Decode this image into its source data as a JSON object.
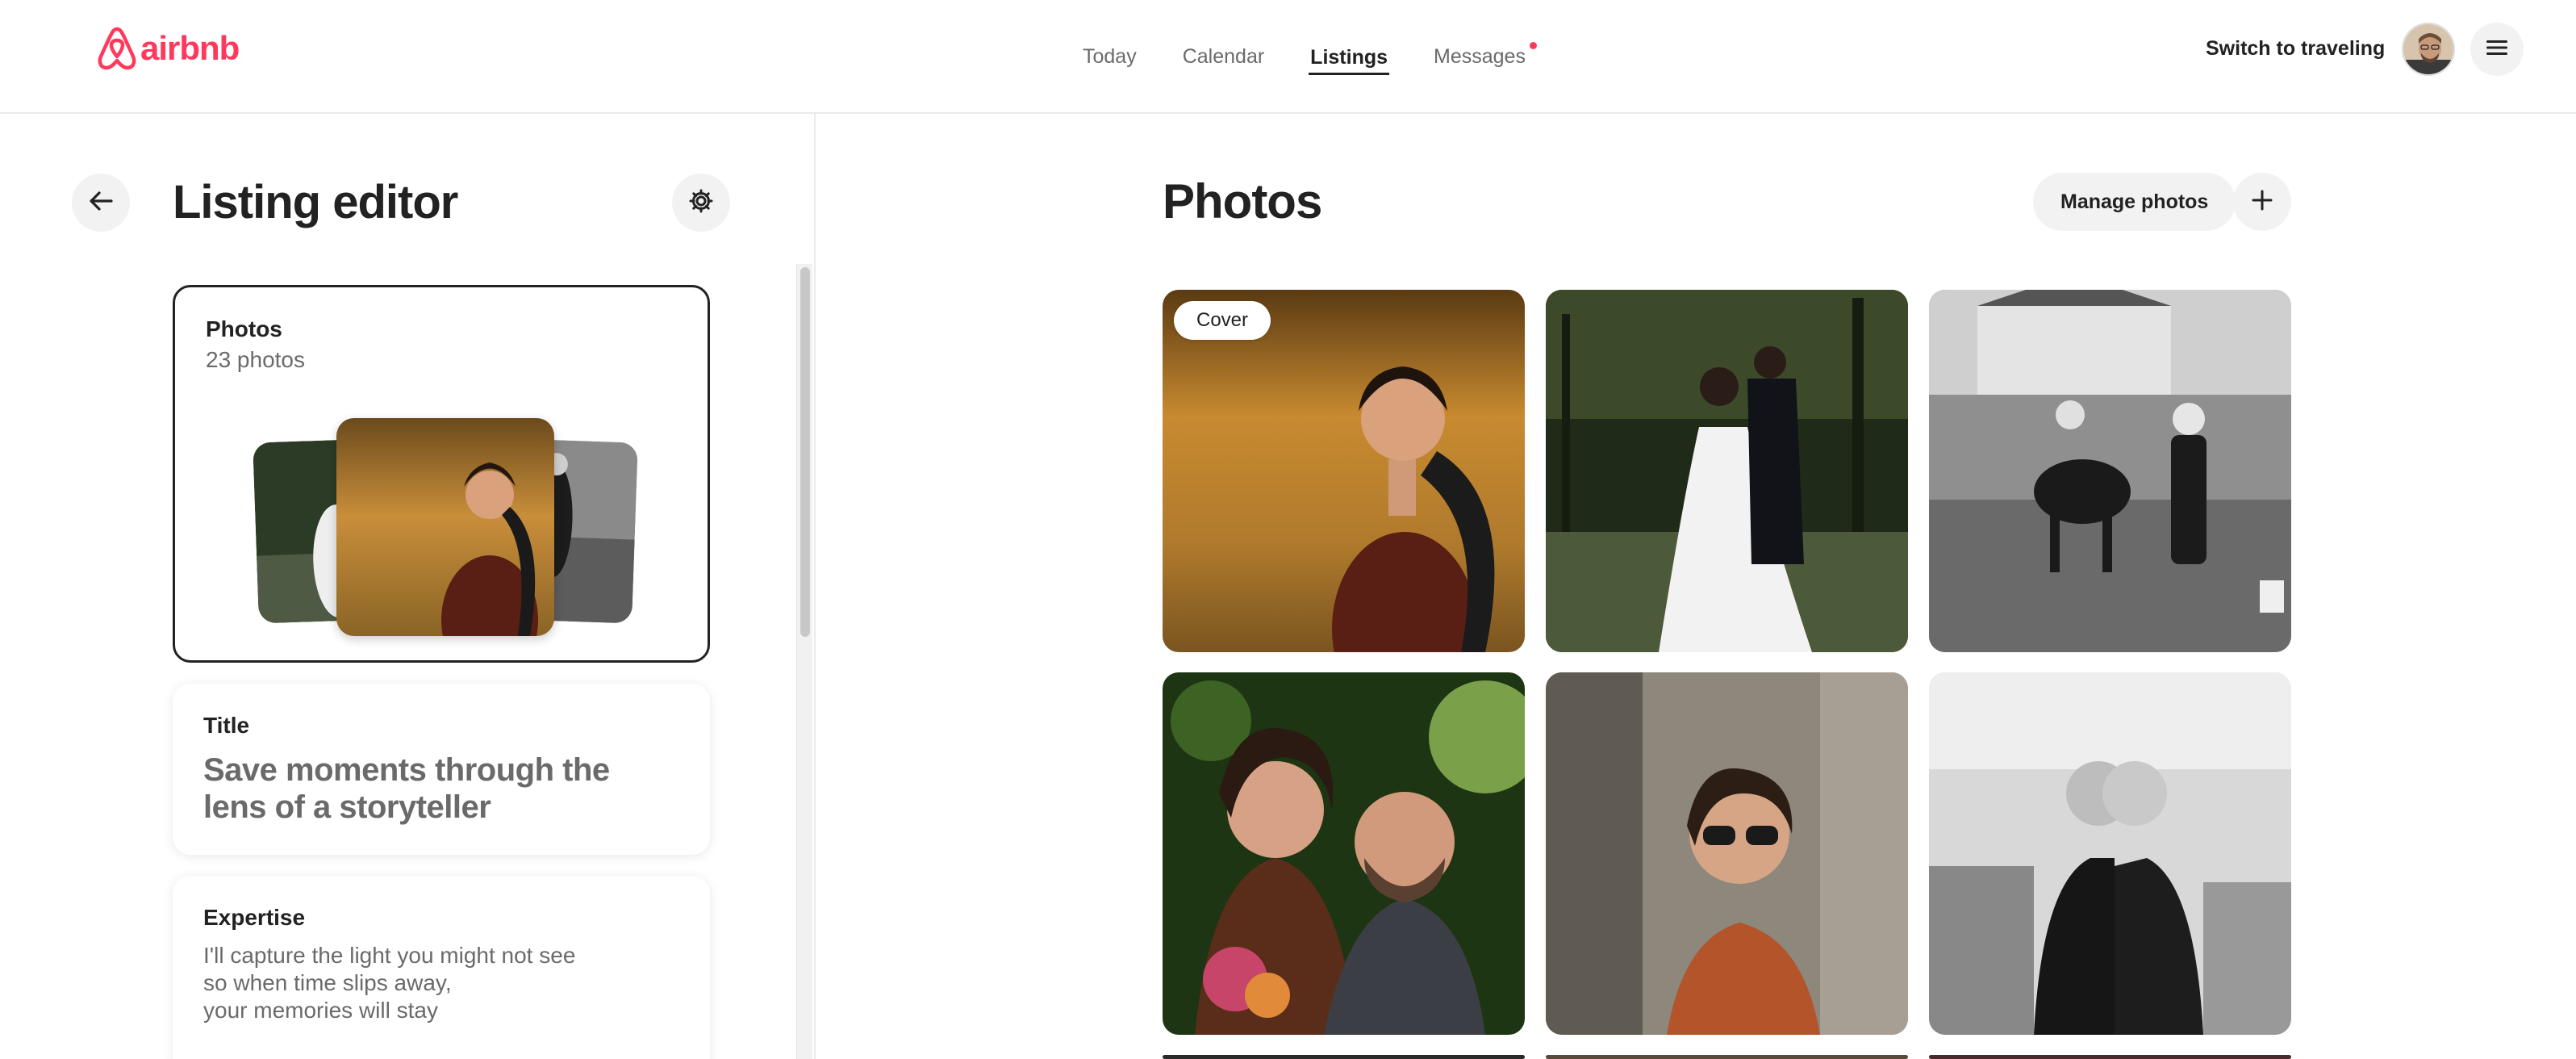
{
  "header": {
    "brand": "airbnb",
    "nav": [
      {
        "label": "Today",
        "active": false
      },
      {
        "label": "Calendar",
        "active": false
      },
      {
        "label": "Listings",
        "active": true
      },
      {
        "label": "Messages",
        "active": false,
        "notification": true
      }
    ],
    "switch_label": "Switch to traveling"
  },
  "editor": {
    "title": "Listing editor",
    "cards": {
      "photos": {
        "label": "Photos",
        "sub": "23 photos"
      },
      "title": {
        "label": "Title",
        "value": "Save moments through the lens of a storyteller"
      },
      "expertise": {
        "label": "Expertise",
        "value": "I'll capture the light you might not see\nso when time slips away,\nyour memories will stay"
      }
    }
  },
  "photos": {
    "title": "Photos",
    "manage_label": "Manage photos",
    "cover_label": "Cover"
  },
  "colors": {
    "brand": "#ff385c",
    "text": "#222222",
    "muted": "#6a6a6a",
    "button_bg": "#f2f2f2"
  },
  "icons": [
    "airbnb-logo-icon",
    "notification-dot-icon",
    "hamburger-menu-icon",
    "arrow-left-icon",
    "gear-icon",
    "plus-icon"
  ]
}
